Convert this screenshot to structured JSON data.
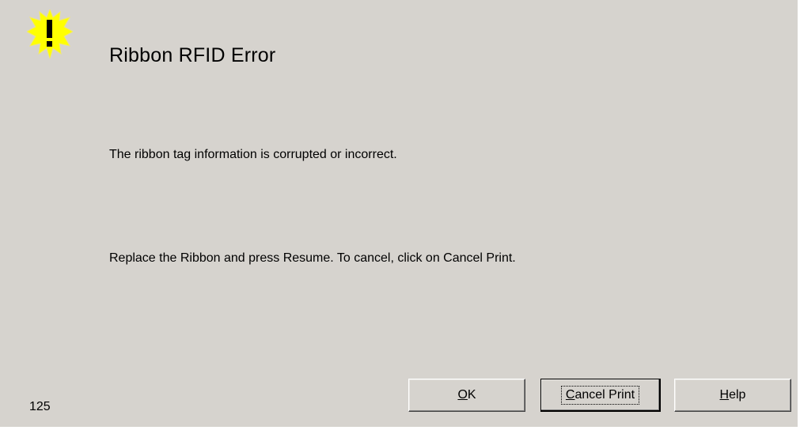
{
  "dialog": {
    "title": "Ribbon RFID Error",
    "message_line1": "The ribbon tag information is corrupted or incorrect.",
    "message_line2": "Replace the Ribbon and press Resume. To cancel, click on Cancel Print.",
    "error_code": "125",
    "icon": "warning-exclamation-icon"
  },
  "buttons": {
    "ok_mnemonic": "O",
    "ok_rest": "K",
    "cancel_mnemonic": "C",
    "cancel_rest": "ancel Print",
    "help_mnemonic": "H",
    "help_rest": "elp"
  },
  "colors": {
    "dialog_bg": "#d6d3ce",
    "icon_yellow": "#ffff00",
    "icon_burst": "#f7f28a"
  }
}
